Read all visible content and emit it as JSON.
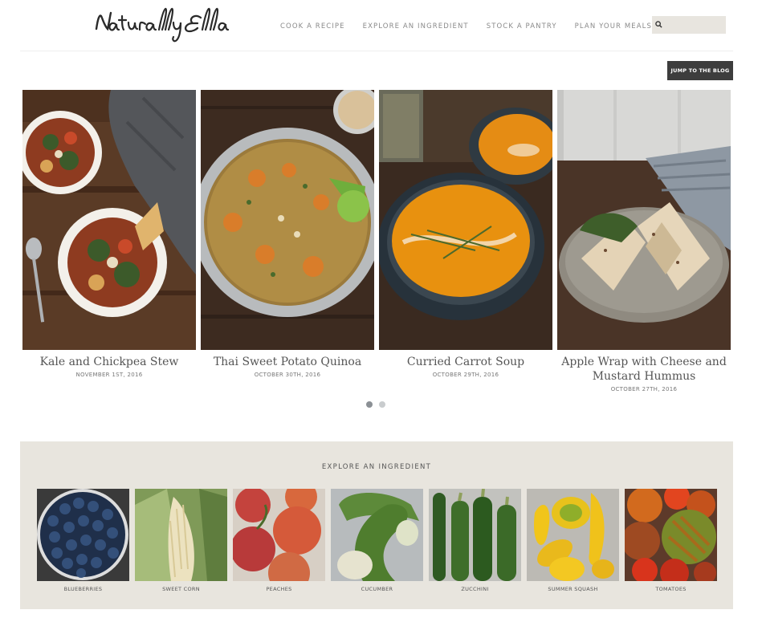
{
  "site": {
    "logo_text": "Naturally Ella"
  },
  "nav": {
    "items": [
      {
        "label": "COOK A RECIPE"
      },
      {
        "label": "EXPLORE AN INGREDIENT"
      },
      {
        "label": "STOCK A PANTRY"
      },
      {
        "label": "PLAN YOUR MEALS"
      }
    ]
  },
  "search": {
    "icon": "search-icon",
    "value": ""
  },
  "blog_button": {
    "label": "JUMP TO THE BLOG"
  },
  "slides": [
    {
      "title": "Kale and Chickpea Stew",
      "date": "NOVEMBER 1ST, 2016"
    },
    {
      "title": "Thai Sweet Potato Quinoa",
      "date": "OCTOBER 30TH, 2016"
    },
    {
      "title": "Curried Carrot Soup",
      "date": "OCTOBER 29TH, 2016"
    },
    {
      "title": "Apple Wrap with Cheese and Mustard Hummus",
      "date": "OCTOBER 27TH, 2016"
    }
  ],
  "pagination": {
    "current": 1,
    "total": 2
  },
  "explore": {
    "heading": "EXPLORE AN INGREDIENT",
    "ingredients": [
      {
        "label": "BLUEBERRIES"
      },
      {
        "label": "SWEET CORN"
      },
      {
        "label": "PEACHES"
      },
      {
        "label": "CUCUMBER"
      },
      {
        "label": "ZUCCHINI"
      },
      {
        "label": "SUMMER SQUASH"
      },
      {
        "label": "TOMATOES"
      }
    ]
  },
  "colors": {
    "accent_dark": "#3d3d3d",
    "explore_bg": "#e8e5de"
  }
}
